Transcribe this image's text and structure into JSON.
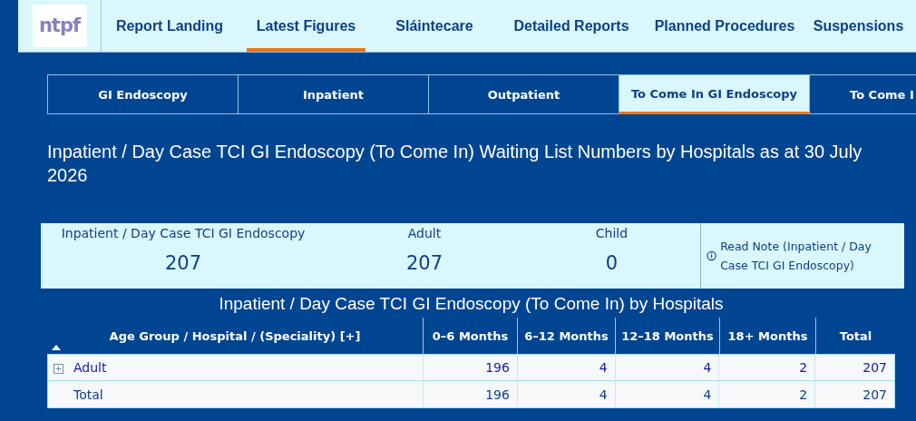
{
  "logo": {
    "text": "ntpf"
  },
  "nav": [
    {
      "label": "Report Landing",
      "selected": false
    },
    {
      "label": "Latest Figures",
      "selected": true
    },
    {
      "label": "Sláintecare",
      "selected": false
    },
    {
      "label": "Detailed Reports",
      "selected": false
    },
    {
      "label": "Planned Procedures",
      "selected": false
    },
    {
      "label": "Suspensions",
      "selected": false
    }
  ],
  "tabs": [
    {
      "label": "GI Endoscopy",
      "selected": false
    },
    {
      "label": "Inpatient",
      "selected": false
    },
    {
      "label": "Outpatient",
      "selected": false
    },
    {
      "label": "To Come In GI Endoscopy",
      "selected": true
    },
    {
      "label": "To Come I",
      "selected": false
    }
  ],
  "title": "Inpatient / Day Case TCI GI Endoscopy (To Come In) Waiting List Numbers by Hospitals as at 30 July 2026",
  "kpis": [
    {
      "label": "Inpatient / Day Case TCI GI Endoscopy",
      "value": "207"
    },
    {
      "label": "Adult",
      "value": "207"
    },
    {
      "label": "Child",
      "value": "0"
    }
  ],
  "note": {
    "text": "Read Note (Inpatient / Day Case TCI GI Endoscopy)"
  },
  "table": {
    "title": "Inpatient / Day Case TCI GI Endoscopy (To Come In) by Hospitals",
    "columns": [
      "Age Group / Hospital / (Speciality) [+]",
      "0–6 Months",
      "6–12 Months",
      "12–18 Months",
      "18+ Months",
      "Total"
    ],
    "rows": [
      {
        "kind": "group",
        "expanded": false,
        "cells": [
          "Adult",
          "196",
          "4",
          "4",
          "2",
          "207"
        ]
      },
      {
        "kind": "total",
        "cells": [
          "Total",
          "196",
          "4",
          "4",
          "2",
          "207"
        ]
      }
    ]
  }
}
